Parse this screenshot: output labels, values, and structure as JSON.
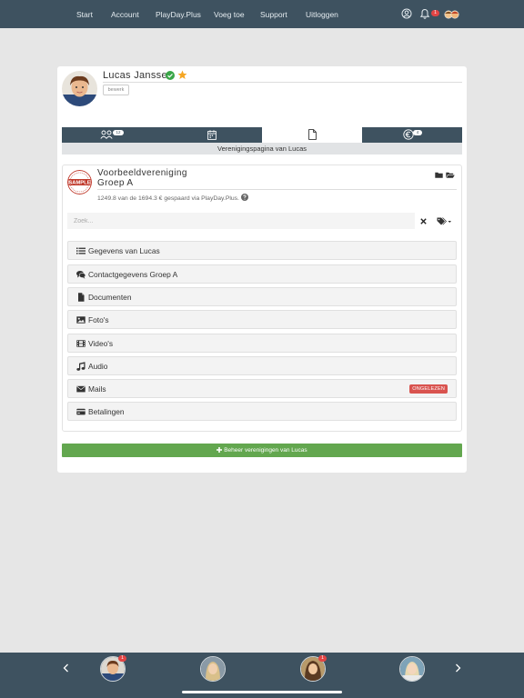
{
  "nav": {
    "start": "Start",
    "account": "Account",
    "playday": "PlayDay.Plus",
    "add": "Voeg toe",
    "support": "Support",
    "logout": "Uitloggen",
    "notification_count": "1"
  },
  "profile": {
    "name": "Lucas Janssen",
    "edit_label": "bewerk"
  },
  "tabs": {
    "members_badge": "12",
    "finance_badge": "4",
    "caption": "Verenigingspagina van Lucas"
  },
  "club": {
    "seal_text": "SAMPLE",
    "name_line1": "Voorbeeldvereniging",
    "name_line2": "Groep A",
    "saved_text": "1249.8 van de 1694.3 € gespaard via PlayDay.Plus.",
    "search_placeholder": "Zoek..."
  },
  "menu": [
    {
      "label": "Gegevens van Lucas",
      "icon": "list-icon"
    },
    {
      "label": "Contactgegevens Groep A",
      "icon": "comments-icon"
    },
    {
      "label": "Documenten",
      "icon": "file-icon"
    },
    {
      "label": "Foto's",
      "icon": "image-icon"
    },
    {
      "label": "Video's",
      "icon": "film-icon"
    },
    {
      "label": "Audio",
      "icon": "music-icon"
    },
    {
      "label": "Mails",
      "icon": "envelope-icon",
      "badge": "ONGELEZEN"
    },
    {
      "label": "Betalingen",
      "icon": "credit-card-icon"
    }
  ],
  "manage_button": "Beheer verenigingen van Lucas",
  "bottom": {
    "avatar1_badge": "1",
    "avatar3_badge": "1"
  },
  "colors": {
    "nav_bg": "#3e5260",
    "accent_green": "#63a74f",
    "unread_red": "#d9534f",
    "star": "#f5a623",
    "verified": "#3aa648"
  }
}
